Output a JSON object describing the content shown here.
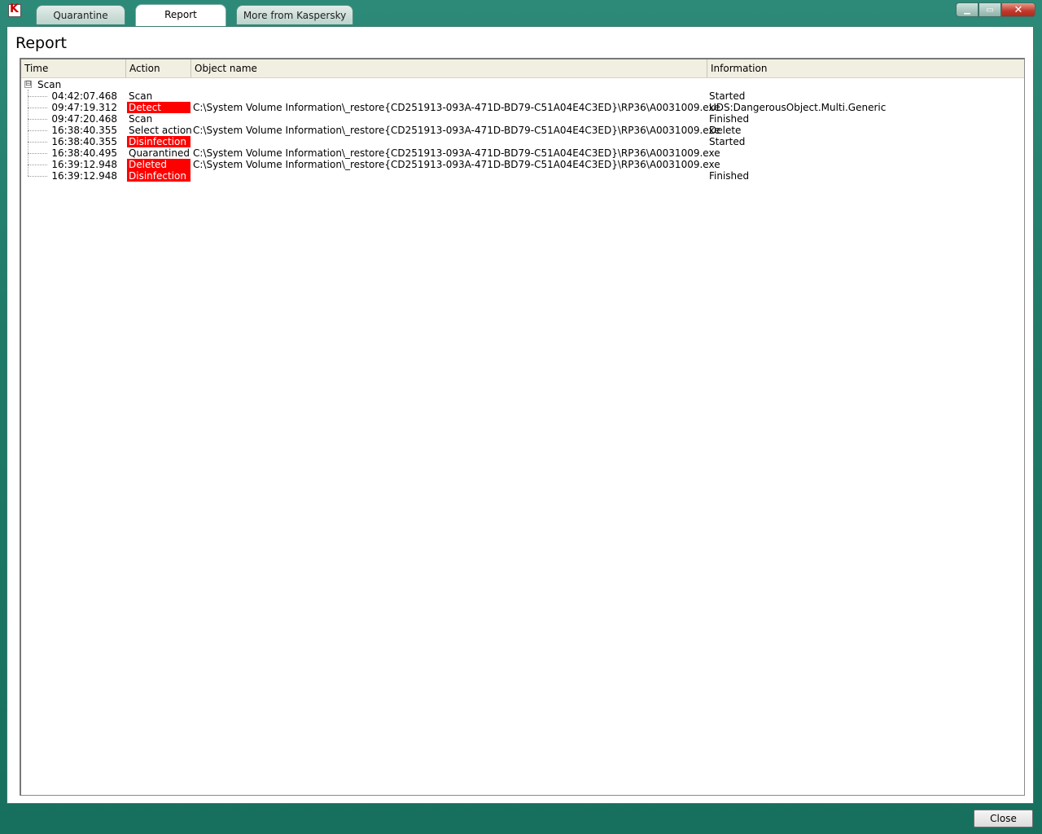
{
  "window": {
    "icon": "kaspersky-k-icon",
    "tabs": [
      {
        "label": "Quarantine",
        "active": false
      },
      {
        "label": "Report",
        "active": true
      },
      {
        "label": "More from Kaspersky",
        "active": false
      }
    ],
    "controls": {
      "minimize": "minimize-icon",
      "maximize": "maximize-icon",
      "close": "close-icon"
    }
  },
  "page": {
    "title": "Report"
  },
  "table": {
    "columns": [
      "Time",
      "Action",
      "Object name",
      "Information"
    ],
    "group": {
      "label": "Scan",
      "toggle": "⊟"
    },
    "rows": [
      {
        "time": "04:42:07.468",
        "action": "Scan",
        "alert": false,
        "object": "",
        "info": "Started"
      },
      {
        "time": "09:47:19.312",
        "action": "Detect",
        "alert": true,
        "object": "C:\\System Volume Information\\_restore{CD251913-093A-471D-BD79-C51A04E4C3ED}\\RP36\\A0031009.exe",
        "info": "UDS:DangerousObject.Multi.Generic"
      },
      {
        "time": "09:47:20.468",
        "action": "Scan",
        "alert": false,
        "object": "",
        "info": "Finished"
      },
      {
        "time": "16:38:40.355",
        "action": "Select action",
        "alert": false,
        "object": "C:\\System Volume Information\\_restore{CD251913-093A-471D-BD79-C51A04E4C3ED}\\RP36\\A0031009.exe",
        "info": "Delete"
      },
      {
        "time": "16:38:40.355",
        "action": "Disinfection",
        "alert": true,
        "object": "",
        "info": "Started"
      },
      {
        "time": "16:38:40.495",
        "action": "Quarantined",
        "alert": false,
        "object": "C:\\System Volume Information\\_restore{CD251913-093A-471D-BD79-C51A04E4C3ED}\\RP36\\A0031009.exe",
        "info": ""
      },
      {
        "time": "16:39:12.948",
        "action": "Deleted",
        "alert": true,
        "object": "C:\\System Volume Information\\_restore{CD251913-093A-471D-BD79-C51A04E4C3ED}\\RP36\\A0031009.exe",
        "info": ""
      },
      {
        "time": "16:39:12.948",
        "action": "Disinfection",
        "alert": true,
        "object": "",
        "info": "Finished"
      }
    ],
    "alert_color": "#ff0000",
    "header_bg": "#f1efe2"
  },
  "footer": {
    "close_label": "Close"
  },
  "colors": {
    "frame": "#1f7a68",
    "content_bg": "#ffffff"
  }
}
